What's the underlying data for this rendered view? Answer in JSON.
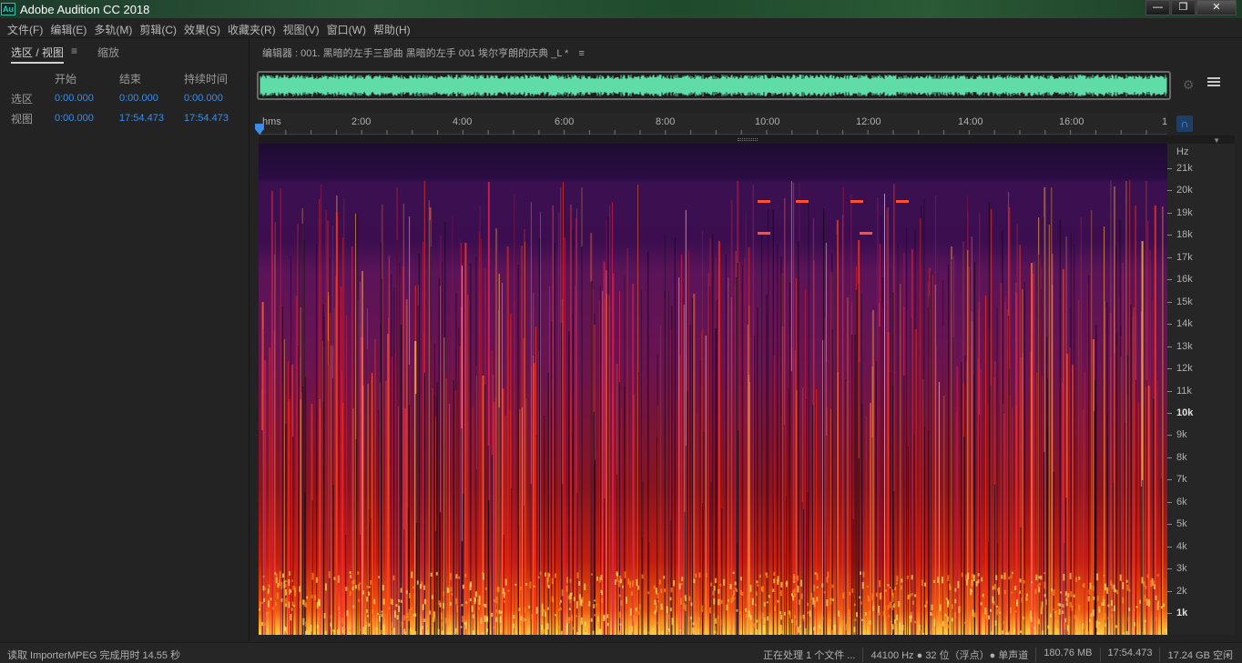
{
  "app": {
    "icon_text": "Au",
    "title": "Adobe Audition CC 2018",
    "window_buttons": [
      "—",
      "❐",
      "✕"
    ]
  },
  "menu": [
    "文件(F)",
    "编辑(E)",
    "多轨(M)",
    "剪辑(C)",
    "效果(S)",
    "收藏夹(R)",
    "视图(V)",
    "窗口(W)",
    "帮助(H)"
  ],
  "left_panel": {
    "tab_selection": "选区 / 视图",
    "tab_menu_icon": "≡",
    "tab_zoom": "缩放",
    "columns": [
      "开始",
      "结束",
      "持续时间"
    ],
    "rows": [
      {
        "label": "选区",
        "start": "0:00.000",
        "end": "0:00.000",
        "duration": "0:00.000"
      },
      {
        "label": "视图",
        "start": "0:00.000",
        "end": "17:54.473",
        "duration": "17:54.473"
      }
    ]
  },
  "editor": {
    "title": "编辑器 : 001. 黑暗的左手三部曲 黑暗的左手 001 埃尔亨朗的庆典 _L *",
    "menu_icon": "≡",
    "zoom_icon": "⚙",
    "snap_icon": "∩",
    "colors": {
      "waveform": "#5fdca8",
      "accent": "#3d8de8"
    }
  },
  "ruler": {
    "labels": [
      "hms",
      "2:00",
      "4:00",
      "6:00",
      "8:00",
      "10:00",
      "12:00",
      "14:00",
      "16:00",
      "1"
    ]
  },
  "hz_axis": {
    "unit": "Hz",
    "labels": [
      {
        "text": "21k",
        "bold": false
      },
      {
        "text": "20k",
        "bold": false
      },
      {
        "text": "19k",
        "bold": false
      },
      {
        "text": "18k",
        "bold": false
      },
      {
        "text": "17k",
        "bold": false
      },
      {
        "text": "16k",
        "bold": false
      },
      {
        "text": "15k",
        "bold": false
      },
      {
        "text": "14k",
        "bold": false
      },
      {
        "text": "13k",
        "bold": false
      },
      {
        "text": "12k",
        "bold": false
      },
      {
        "text": "11k",
        "bold": false
      },
      {
        "text": "10k",
        "bold": true
      },
      {
        "text": "9k",
        "bold": false
      },
      {
        "text": "8k",
        "bold": false
      },
      {
        "text": "7k",
        "bold": false
      },
      {
        "text": "6k",
        "bold": false
      },
      {
        "text": "5k",
        "bold": false
      },
      {
        "text": "4k",
        "bold": false
      },
      {
        "text": "3k",
        "bold": false
      },
      {
        "text": "2k",
        "bold": false
      },
      {
        "text": "1k",
        "bold": true
      }
    ]
  },
  "status": {
    "left": "读取 ImporterMPEG 完成用时 14.55 秒",
    "processing": "正在处理 1 个文件 ...",
    "format": "44100 Hz ● 32 位（浮点）● 单声道",
    "size": "180.76 MB",
    "duration": "17:54.473",
    "free": "17.24 GB 空闲"
  }
}
